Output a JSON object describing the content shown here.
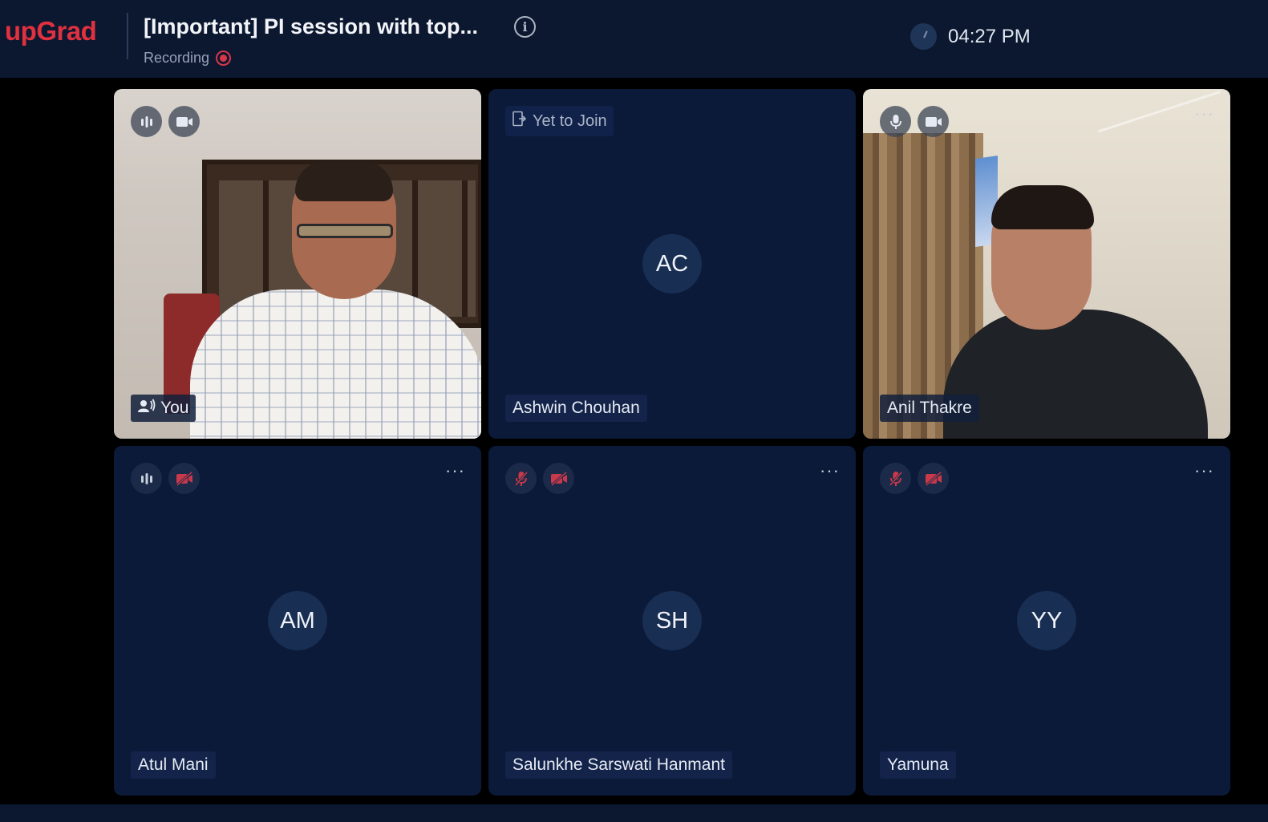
{
  "header": {
    "brand": "upGrad",
    "title": "[Important] PI session with top...",
    "recording_label": "Recording",
    "time": "04:27 PM"
  },
  "tiles": [
    {
      "name": "You",
      "type": "video",
      "mic": "speaking",
      "camera": "on",
      "speaking_icon": "person-speaking-icon"
    },
    {
      "name": "Ashwin Chouhan",
      "type": "avatar",
      "initials": "AC",
      "status": "Yet to Join"
    },
    {
      "name": "Anil Thakre",
      "type": "video",
      "mic": "on",
      "camera": "on"
    },
    {
      "name": "Atul Mani",
      "type": "avatar",
      "initials": "AM",
      "mic": "speaking",
      "camera": "off"
    },
    {
      "name": "Salunkhe Sarswati Hanmant",
      "type": "avatar",
      "initials": "SH",
      "mic": "off",
      "camera": "off"
    },
    {
      "name": "Yamuna",
      "type": "avatar",
      "initials": "YY",
      "mic": "off",
      "camera": "off"
    }
  ],
  "colors": {
    "brand": "#e0313f",
    "header_bg": "#0b1830",
    "tile_bg": "#0b1a39",
    "muted_red": "#c9394b",
    "recording_red": "#d9364a"
  },
  "more_label": "···"
}
